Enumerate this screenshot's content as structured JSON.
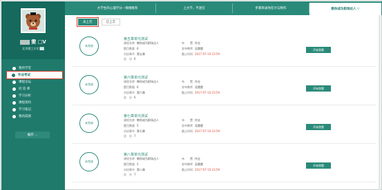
{
  "sidebar": {
    "username_suffix": "雯 □V",
    "user_sub": "北京理工大学 ██",
    "menu": [
      {
        "label": "我的学堂",
        "icon": "home-icon"
      },
      {
        "label": "作业考试",
        "icon": "exam-icon",
        "active": true
      },
      {
        "label": "课程论坛",
        "icon": "forum-icon"
      },
      {
        "label": "问 答 库",
        "icon": "question-icon"
      },
      {
        "label": "学习分析",
        "icon": "analysis-icon"
      },
      {
        "label": "课程资料",
        "icon": "material-icon"
      },
      {
        "label": "学习笔记",
        "icon": "note-icon"
      },
      {
        "label": "我的成绩",
        "icon": "grade-icon"
      }
    ],
    "collapse_label": "展开 ..."
  },
  "topnav": {
    "tabs": [
      {
        "label": "大学生的心理学分—情绪教育",
        "active": false
      },
      {
        "label": "上大学，不迷茫",
        "active": false
      },
      {
        "label": "步骤目录你在计与制作",
        "active": false
      },
      {
        "label": "教你成为职场达人 ▽",
        "active": true
      }
    ]
  },
  "filter": {
    "chips": [
      {
        "label": "未上交",
        "active": true
      },
      {
        "label": "已上交",
        "active": false
      }
    ]
  },
  "labels": {
    "course": "课程名称",
    "direction": "布　　置",
    "count": "题目数量",
    "publisher": "发布教师",
    "chapter": "对应章节",
    "deadline": "截止时间",
    "score": "总　分",
    "type": "作业"
  },
  "items": [
    {
      "status": "未完成",
      "title": "第五章单元测试",
      "course": "教你成为职场达人",
      "count": "6",
      "publisher": "吴雷雷",
      "chapter": "第五章",
      "deadline": "2017-07-10 23:59",
      "score": "6",
      "action": "开始答题"
    },
    {
      "status": "未完成",
      "title": "第六章单元测试",
      "course": "教你成为职场达人",
      "count": "6",
      "publisher": "吴雷雷",
      "chapter": "第六章",
      "deadline": "2017-07-10 23:59",
      "score": "6",
      "action": "开始答题"
    },
    {
      "status": "未完成",
      "title": "第七章单元测试",
      "course": "教你成为职场达人",
      "count": "5",
      "publisher": "吴雷雷",
      "chapter": "第七章",
      "deadline": "2017-07-10 23:59",
      "score": "7",
      "action": "开始答题"
    },
    {
      "status": "未完成",
      "title": "第八章单元测试",
      "course": "教你成为职场达人",
      "count": "5",
      "publisher": "吴雷雷",
      "chapter": "第八章",
      "deadline": "2017-07-10 23:59",
      "score": "7",
      "action": "开始答题"
    }
  ],
  "colors": {
    "primary": "#2a8a7a",
    "sidebar": "#1f7a6c",
    "highlight": "#d93b2b"
  }
}
